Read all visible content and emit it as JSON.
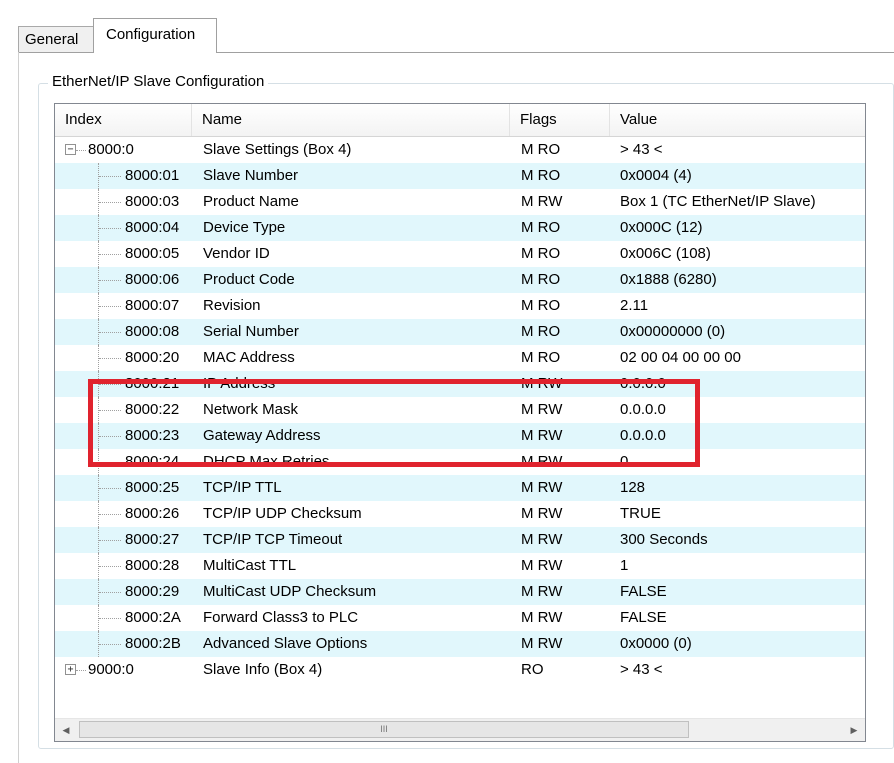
{
  "tabs": [
    {
      "label": "General"
    },
    {
      "label": "Configuration"
    }
  ],
  "group": {
    "title": "EtherNet/IP Slave Configuration"
  },
  "columns": [
    "Index",
    "Name",
    "Flags",
    "Value"
  ],
  "rows": [
    {
      "index": "8000:0",
      "name": "Slave Settings (Box 4)",
      "flags": "M RO",
      "value": "> 43 <",
      "level": 0,
      "expander": "−"
    },
    {
      "index": "8000:01",
      "name": "Slave Number",
      "flags": "M RO",
      "value": "0x0004 (4)",
      "level": 1
    },
    {
      "index": "8000:03",
      "name": "Product Name",
      "flags": "M RW",
      "value": "Box 1 (TC EtherNet/IP Slave)",
      "level": 1
    },
    {
      "index": "8000:04",
      "name": "Device Type",
      "flags": "M RO",
      "value": "0x000C (12)",
      "level": 1
    },
    {
      "index": "8000:05",
      "name": "Vendor ID",
      "flags": "M RO",
      "value": "0x006C (108)",
      "level": 1
    },
    {
      "index": "8000:06",
      "name": "Product Code",
      "flags": "M RO",
      "value": "0x1888 (6280)",
      "level": 1
    },
    {
      "index": "8000:07",
      "name": "Revision",
      "flags": "M RO",
      "value": "2.11",
      "level": 1
    },
    {
      "index": "8000:08",
      "name": "Serial Number",
      "flags": "M RO",
      "value": "0x00000000 (0)",
      "level": 1
    },
    {
      "index": "8000:20",
      "name": "MAC Address",
      "flags": "M RO",
      "value": "02 00 04 00 00 00",
      "level": 1
    },
    {
      "index": "8000:21",
      "name": "IP Address",
      "flags": "M RW",
      "value": "0.0.0.0",
      "level": 1
    },
    {
      "index": "8000:22",
      "name": "Network Mask",
      "flags": "M RW",
      "value": "0.0.0.0",
      "level": 1
    },
    {
      "index": "8000:23",
      "name": "Gateway Address",
      "flags": "M RW",
      "value": "0.0.0.0",
      "level": 1
    },
    {
      "index": "8000:24",
      "name": "DHCP Max Retries",
      "flags": "M RW",
      "value": "0",
      "level": 1
    },
    {
      "index": "8000:25",
      "name": "TCP/IP TTL",
      "flags": "M RW",
      "value": "128",
      "level": 1
    },
    {
      "index": "8000:26",
      "name": "TCP/IP UDP Checksum",
      "flags": "M RW",
      "value": "TRUE",
      "level": 1
    },
    {
      "index": "8000:27",
      "name": "TCP/IP TCP Timeout",
      "flags": "M RW",
      "value": "300 Seconds",
      "level": 1
    },
    {
      "index": "8000:28",
      "name": "MultiCast TTL",
      "flags": "M RW",
      "value": "1",
      "level": 1
    },
    {
      "index": "8000:29",
      "name": "MultiCast UDP Checksum",
      "flags": "M RW",
      "value": "FALSE",
      "level": 1
    },
    {
      "index": "8000:2A",
      "name": "Forward Class3 to PLC",
      "flags": "M RW",
      "value": "FALSE",
      "level": 1
    },
    {
      "index": "8000:2B",
      "name": "Advanced Slave Options",
      "flags": "M RW",
      "value": "0x0000 (0)",
      "level": 1
    },
    {
      "index": "9000:0",
      "name": "Slave Info (Box 4)",
      "flags": "RO",
      "value": "> 43 <",
      "level": 0,
      "expander": "+"
    }
  ],
  "scrollbar": {
    "thumb_grip": "III"
  },
  "colors": {
    "highlight": "#e0232e",
    "alt_row": "#e1f7fc"
  }
}
